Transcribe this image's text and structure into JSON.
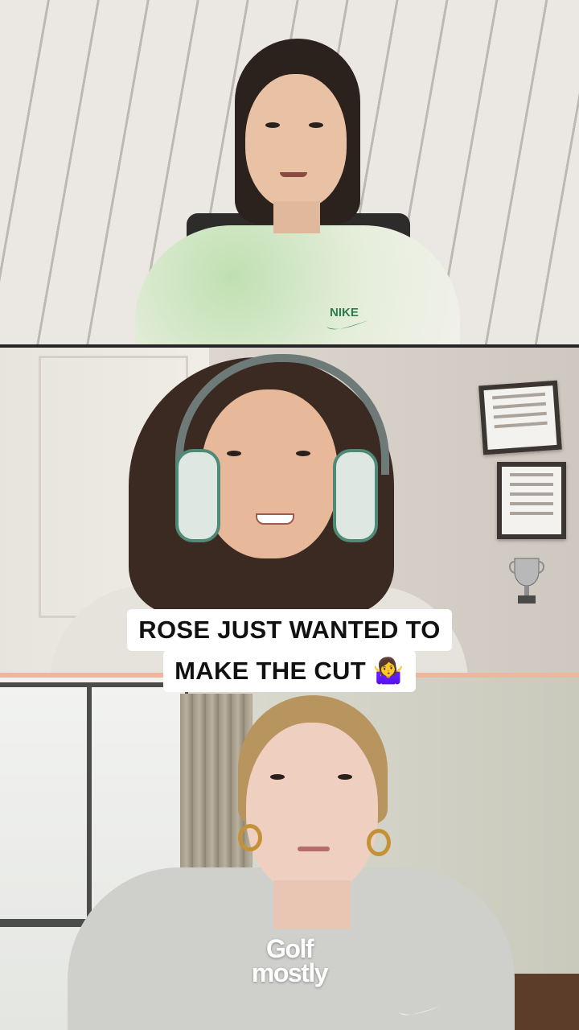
{
  "caption": {
    "line1": "ROSE JUST WANTED TO",
    "line2": "MAKE THE CUT",
    "emoji": "🤷‍♀️"
  },
  "logo": {
    "line1": "Golf",
    "line2": "mostly"
  },
  "panels": [
    {
      "name": "top-participant",
      "apparel_brand": "NIKE"
    },
    {
      "name": "middle-participant"
    },
    {
      "name": "bottom-participant"
    }
  ],
  "colors": {
    "separator_dark": "#262626",
    "separator_peach": "#f0b59f",
    "caption_bg": "#ffffff",
    "caption_text": "#111111"
  }
}
